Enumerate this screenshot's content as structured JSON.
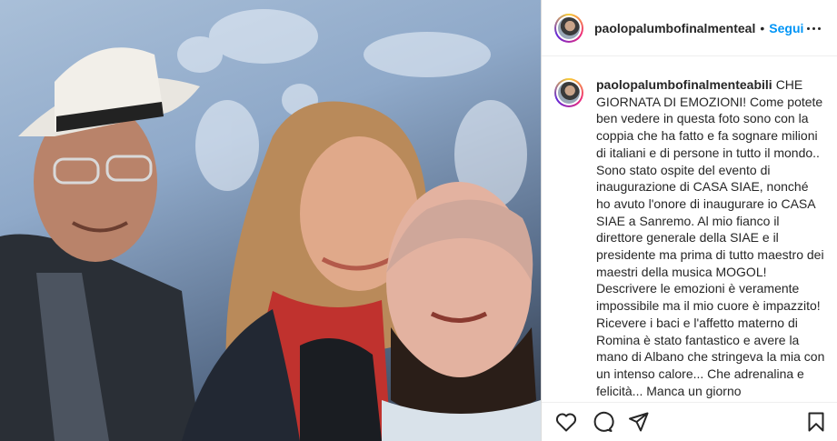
{
  "post": {
    "header_username": "paolopalumbofinalmenteal",
    "separator": "•",
    "follow_label": "Segui",
    "caption_username": "paolopalumbofinalmenteabili",
    "caption_text": "CHE GIORNATA DI EMOZIONI! Come potete ben vedere in questa foto sono con la coppia che ha fatto e fa sognare milioni di italiani e di persone in tutto il mondo.. Sono stato ospite del evento di inaugurazione di CASA SIAE, nonché ho avuto l'onore di inaugurare io CASA SIAE a Sanremo. Al mio fianco il direttore generale della SIAE e il presidente ma prima di tutto maestro dei maestri della musica MOGOL! Descrivere le emozioni è veramente impossibile ma il mio cuore è impazzito! Ricevere i baci e l'affetto materno di Romina è stato fantastico e avere la mano di Albano che stringeva la mia con un intenso calore... Che adrenalina e felicità... Manca un giorno"
  },
  "icons": {
    "like": "heart-icon",
    "comment": "comment-icon",
    "share": "paper-plane-icon",
    "save": "bookmark-icon",
    "more": "more-options-icon"
  },
  "colors": {
    "follow": "#0095f6",
    "text": "#262626",
    "border": "#dbdbdb"
  }
}
